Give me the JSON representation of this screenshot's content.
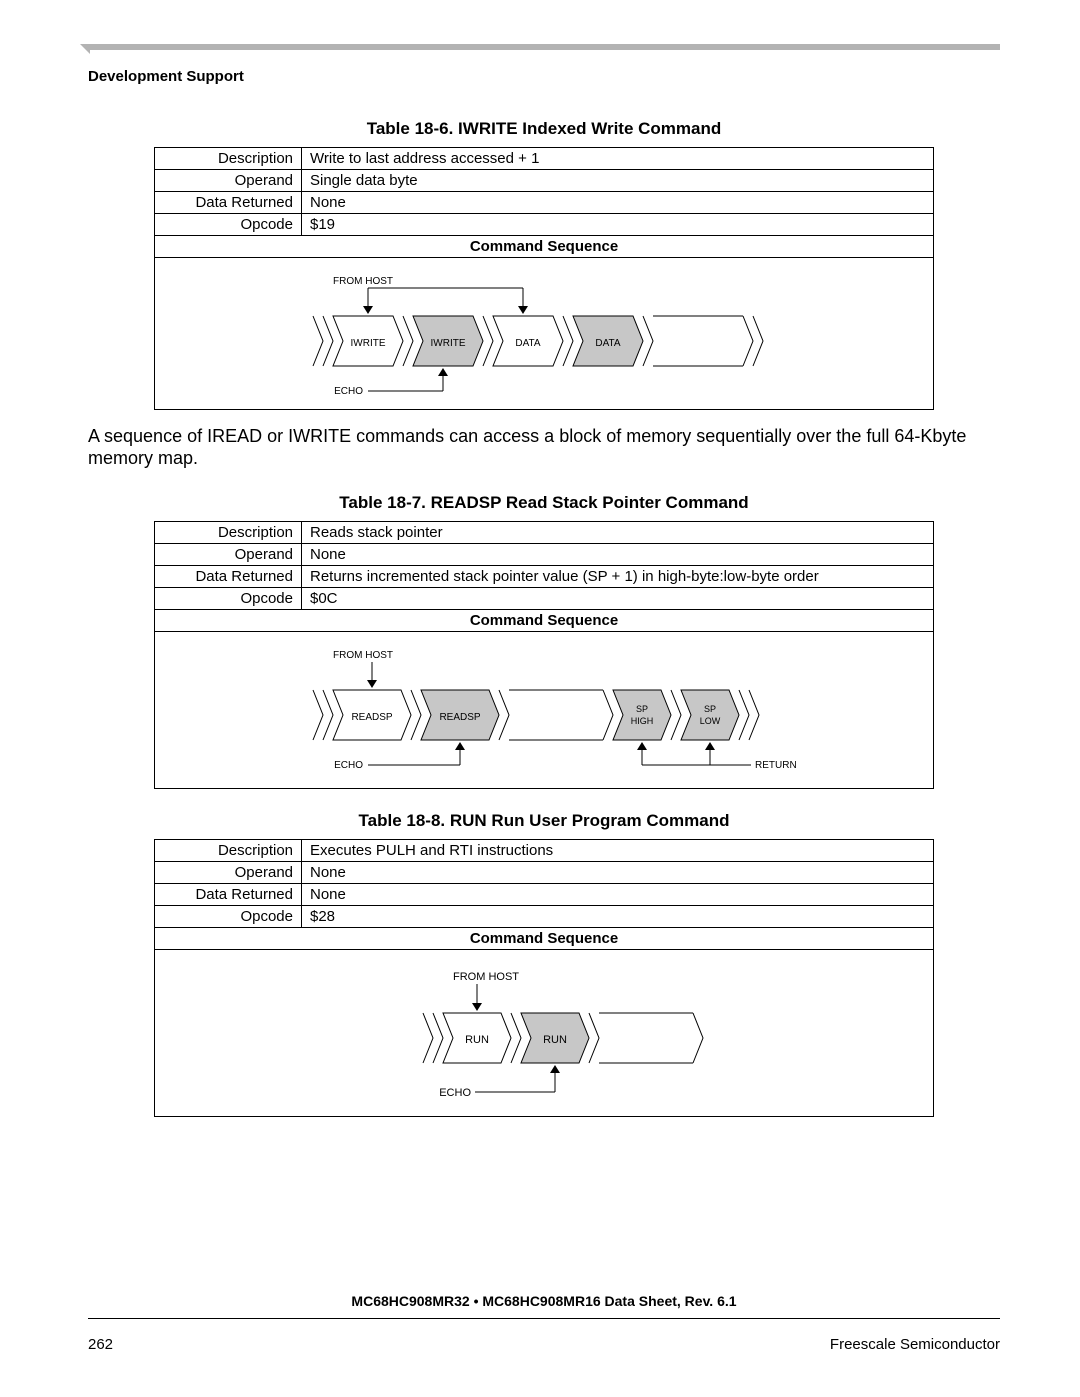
{
  "header": {
    "section_title": "Development Support"
  },
  "tables": [
    {
      "title": "Table 18-6. IWRITE Indexed Write Command",
      "rows": [
        {
          "label": "Description",
          "value": "Write to last address accessed + 1"
        },
        {
          "label": "Operand",
          "value": "Single data byte"
        },
        {
          "label": "Data Returned",
          "value": "None"
        },
        {
          "label": "Opcode",
          "value": "$19"
        }
      ],
      "seq_title": "Command Sequence",
      "labels": {
        "from_host": "FROM HOST",
        "echo": "ECHO",
        "b1": "IWRITE",
        "b2": "IWRITE",
        "b3": "DATA",
        "b4": "DATA"
      }
    },
    {
      "title": "Table 18-7. READSP Read Stack Pointer Command",
      "rows": [
        {
          "label": "Description",
          "value": "Reads stack pointer"
        },
        {
          "label": "Operand",
          "value": "None"
        },
        {
          "label": "Data Returned",
          "value": "Returns incremented stack pointer value (SP + 1) in high-byte:low-byte order"
        },
        {
          "label": "Opcode",
          "value": "$0C"
        }
      ],
      "seq_title": "Command Sequence",
      "labels": {
        "from_host": "FROM HOST",
        "echo": "ECHO",
        "return": "RETURN",
        "b1": "READSP",
        "b2": "READSP",
        "b3_line1": "SP",
        "b3_line2": "HIGH",
        "b4_line1": "SP",
        "b4_line2": "LOW"
      }
    },
    {
      "title": "Table 18-8. RUN Run User Program Command",
      "rows": [
        {
          "label": "Description",
          "value": "Executes PULH and RTI instructions"
        },
        {
          "label": "Operand",
          "value": "None"
        },
        {
          "label": "Data Returned",
          "value": "None"
        },
        {
          "label": "Opcode",
          "value": "$28"
        }
      ],
      "seq_title": "Command Sequence",
      "labels": {
        "from_host": "FROM HOST",
        "echo": "ECHO",
        "b1": "RUN",
        "b2": "RUN"
      }
    }
  ],
  "body_note": "A sequence of IREAD or IWRITE commands can access a block of memory sequentially over the full 64-Kbyte memory map.",
  "footer": {
    "doc_id": "MC68HC908MR32 • MC68HC908MR16 Data Sheet, Rev. 6.1",
    "page_num": "262",
    "company": "Freescale Semiconductor"
  }
}
